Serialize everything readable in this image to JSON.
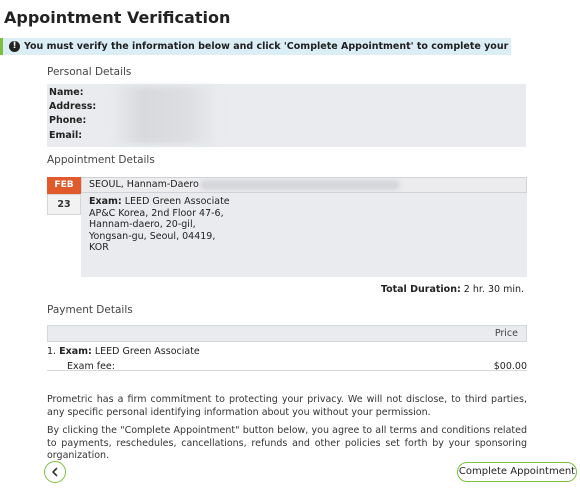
{
  "page": {
    "title": "Appointment Verification",
    "alert": "You must verify the information below and click 'Complete Appointment' to complete your transaction.",
    "alert_icon": "exclamation-circle-icon"
  },
  "personal": {
    "section_title": "Personal Details",
    "labels": [
      "Name:",
      "Address:",
      "Phone:",
      "Email:"
    ]
  },
  "appointment": {
    "section_title": "Appointment Details",
    "month": "FEB",
    "day": "23",
    "site": "SEOUL, Hannam-Daero",
    "exam_label": "Exam:",
    "exam_name": "LEED Green Associate",
    "address_lines": [
      "AP&C Korea, 2nd Floor 47-6,",
      "Hannam-daero, 20-gil,",
      "Yongsan-gu, Seoul, 04419,",
      "KOR"
    ],
    "duration_label": "Total Duration:",
    "duration_value": "2 hr. 30 min."
  },
  "payment": {
    "section_title": "Payment Details",
    "price_header": "Price",
    "item_number": "1.",
    "item_label": "Exam:",
    "item_name": "LEED Green Associate",
    "fee_label": "Exam fee:",
    "fee_value": "$00.00"
  },
  "policy": {
    "privacy": "Prometric has a firm commitment to protecting your privacy. We will not disclose, to third parties, any specific personal identifying information about you without your permission.",
    "terms": "By clicking the \"Complete Appointment\" button below, you agree to all terms and conditions related to payments, reschedules, cancellations, refunds and other policies set forth by your sponsoring organization."
  },
  "actions": {
    "back_icon": "chevron-left-icon",
    "complete_label": "Complete Appointment"
  },
  "colors": {
    "accent": "#7fbf3f",
    "alert_bg": "#dbeef6",
    "date_month": "#e05a2b"
  }
}
